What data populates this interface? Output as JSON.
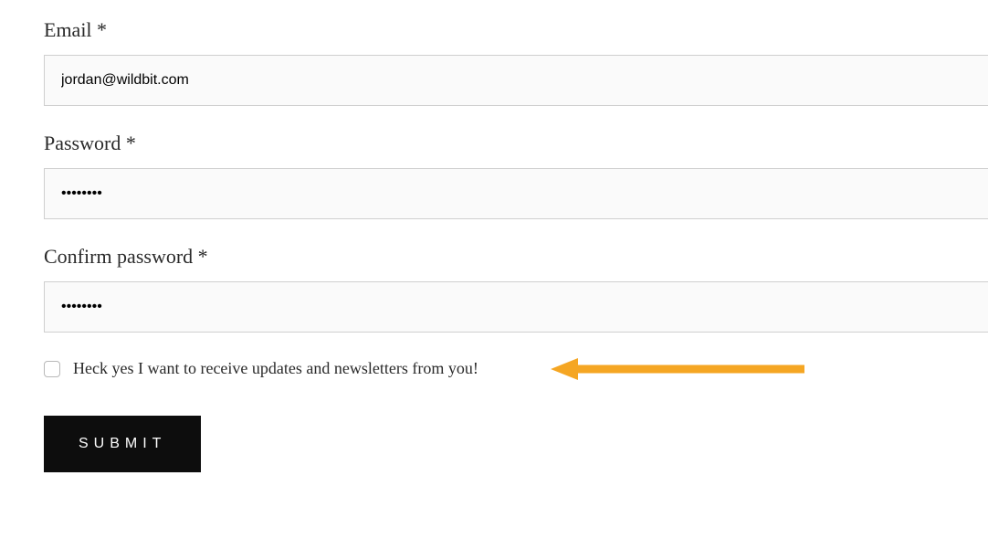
{
  "form": {
    "email": {
      "label": "Email *",
      "value": "jordan@wildbit.com"
    },
    "password": {
      "label": "Password *",
      "value": "••••••••"
    },
    "confirmPassword": {
      "label": "Confirm password *",
      "value": "••••••••"
    },
    "newsletter": {
      "label": "Heck yes I want to receive updates and newsletters from you!",
      "checked": false
    },
    "submit": {
      "label": "SUBMIT"
    }
  },
  "annotation": {
    "arrowColor": "#f5a623"
  }
}
